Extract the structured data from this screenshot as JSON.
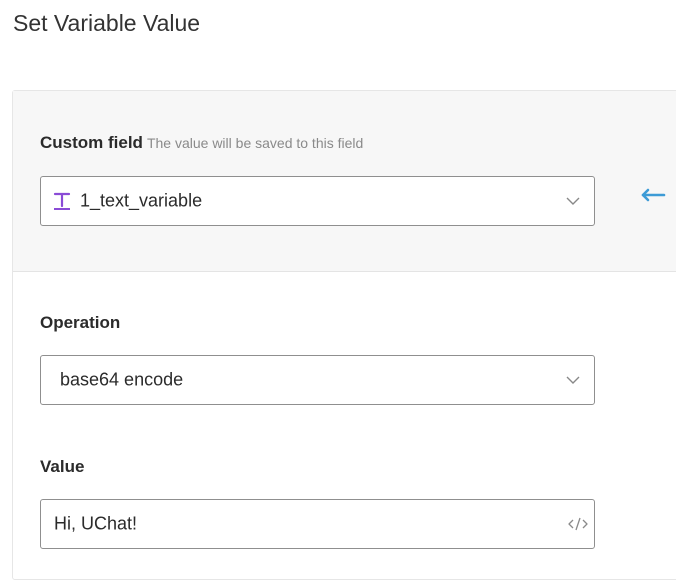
{
  "page": {
    "title": "Set Variable Value"
  },
  "custom_field": {
    "label": "Custom field",
    "hint": "The value will be saved to this field",
    "selected": "1_text_variable",
    "type_icon": "text-type-icon"
  },
  "operation": {
    "label": "Operation",
    "selected": "base64 encode"
  },
  "value": {
    "label": "Value",
    "text": "Hi, UChat!"
  },
  "colors": {
    "accent_blue": "#3d9bd6",
    "type_icon_purple": "#8a4bd6",
    "border": "#8f8f8f"
  }
}
